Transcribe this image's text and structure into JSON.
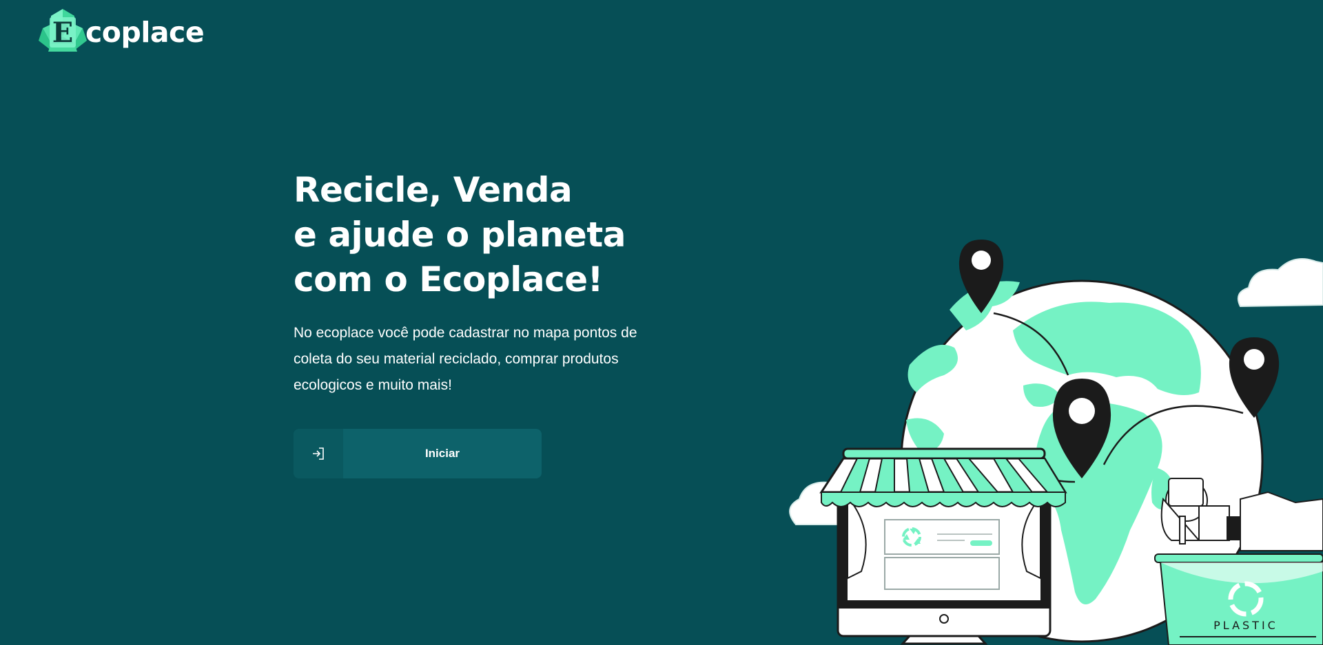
{
  "brand": {
    "logo_letter": "E",
    "name": "coplace",
    "accent": "#6ef0bf",
    "background": "#064f56"
  },
  "hero": {
    "title_lines": [
      "Recicle, Venda",
      "e ajude o planeta",
      "com o Ecoplace!"
    ],
    "description": "No ecoplace você pode cadastrar no mapa pontos de coleta do seu material reciclado, comprar produtos ecologicos e muito mais!"
  },
  "cta": {
    "label": "Iniciar",
    "icon": "login-icon"
  },
  "illustration": {
    "bin_label": "PLASTIC",
    "icons": [
      "globe-icon",
      "map-pin-icon",
      "storefront-icon",
      "recycle-icon",
      "cloud-icon",
      "recycling-bin-icon"
    ]
  }
}
